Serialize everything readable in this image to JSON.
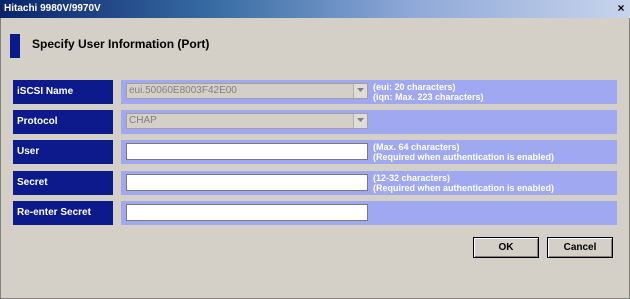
{
  "window": {
    "title": "Hitachi 9980V/9970V",
    "close_glyph": "×"
  },
  "page": {
    "heading": "Specify User Information (Port)"
  },
  "form": {
    "iscsi_name": {
      "label": "iSCSI Name",
      "value": "eui.50060E8003F42E00",
      "hint_line1": "(eui: 20 characters)",
      "hint_line2": "(iqn: Max. 223 characters)"
    },
    "protocol": {
      "label": "Protocol",
      "value": "CHAP"
    },
    "user": {
      "label": "User",
      "value": "",
      "hint_line1": "(Max. 64 characters)",
      "hint_line2": "(Required when authentication is enabled)"
    },
    "secret": {
      "label": "Secret",
      "value": "",
      "hint_line1": "(12-32 characters)",
      "hint_line2": "(Required when authentication is enabled)"
    },
    "reenter_secret": {
      "label": "Re-enter Secret",
      "value": ""
    }
  },
  "buttons": {
    "ok": "OK",
    "cancel": "Cancel"
  },
  "colors": {
    "label_bg": "#0d1a8c",
    "field_bg": "#9fa8f0",
    "window_bg": "#d4d0c8"
  }
}
